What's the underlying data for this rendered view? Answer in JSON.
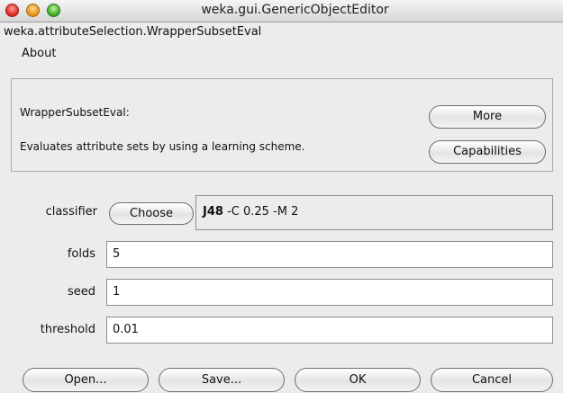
{
  "window": {
    "title": "weka.gui.GenericObjectEditor",
    "class_name": "weka.attributeSelection.WrapperSubsetEval"
  },
  "about": {
    "legend": "About",
    "name": "WrapperSubsetEval:",
    "description": "Evaluates attribute sets by using a learning scheme.",
    "more_label": "More",
    "capabilities_label": "Capabilities"
  },
  "fields": {
    "classifier_label": "classifier",
    "choose_label": "Choose",
    "classifier_name": "J48",
    "classifier_options": " -C 0.25 -M 2",
    "folds_label": "folds",
    "folds_value": "5",
    "seed_label": "seed",
    "seed_value": "1",
    "threshold_label": "threshold",
    "threshold_value": "0.01"
  },
  "footer": {
    "open_label": "Open...",
    "save_label": "Save...",
    "ok_label": "OK",
    "cancel_label": "Cancel"
  }
}
